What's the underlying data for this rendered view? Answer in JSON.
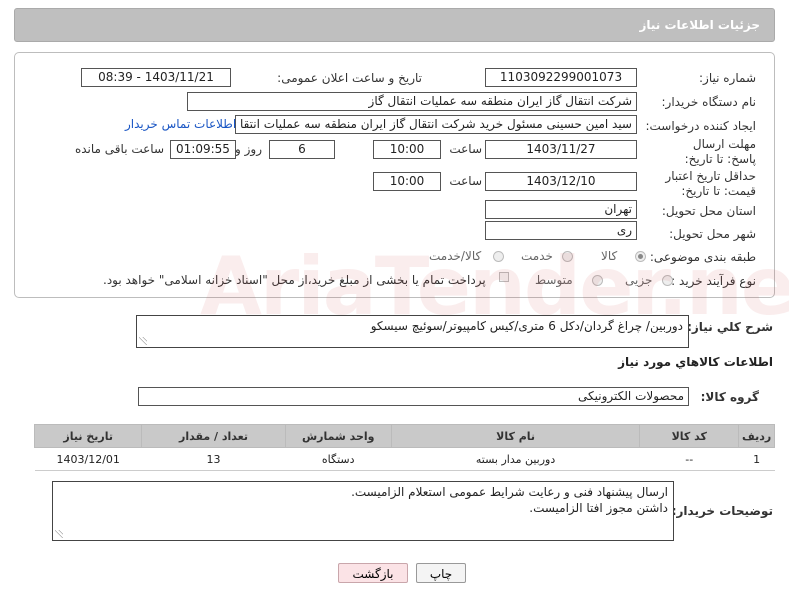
{
  "header": {
    "title": "جزئیات اطلاعات نیاز"
  },
  "labels": {
    "need_number": "شماره نیاز:",
    "announce_datetime": "تاریخ و ساعت اعلان عمومی:",
    "buyer_org": "نام دستگاه خریدار:",
    "requester": "ایجاد کننده درخواست:",
    "response_deadline": "مهلت ارسال پاسخ: تا تاریخ:",
    "price_validity": "حداقل تاریخ اعتبار قیمت: تا تاریخ:",
    "province": "استان محل تحویل:",
    "city": "شهر محل تحویل:",
    "category": "طبقه بندی موضوعی:",
    "process_type": "نوع فرآیند خرید :",
    "time": "ساعت",
    "day_and": "روز و",
    "remaining": "ساعت باقی مانده",
    "general_desc": "شرح کلي نياز:",
    "goods_info": "اطلاعات کالاهاي مورد نياز",
    "goods_group": "گروه کالا:",
    "buyer_notes": "توضیحات خریدار:"
  },
  "values": {
    "need_number": "1103092299001073",
    "announce_datetime": "1403/11/21 - 08:39",
    "buyer_org": "شرکت انتقال گاز ایران منطقه سه عملیات انتقال گاز",
    "requester": "سید امین حسینی مسئول خرید شرکت انتقال گاز ایران منطقه سه عملیات انتقا",
    "contact_link": "اطلاعات تماس خریدار",
    "response_date": "1403/11/27",
    "response_time": "10:00",
    "days": "6",
    "remaining_time": "01:09:55",
    "validity_date": "1403/12/10",
    "validity_time": "10:00",
    "province": "تهران",
    "city": "ری",
    "general_desc": "دوربین/ چراغ گردان/دکل 6 متری/کیس کامپیوتر/سوئیچ سیسکو",
    "goods_group": "محصولات الکترونیکی"
  },
  "category_options": [
    {
      "label": "کالا",
      "selected": true
    },
    {
      "label": "خدمت",
      "selected": false
    },
    {
      "label": "کالا/خدمت",
      "selected": false
    }
  ],
  "process_options": [
    {
      "label": "جزیی",
      "selected": false
    },
    {
      "label": "متوسط",
      "selected": false
    }
  ],
  "payment_note": "پرداخت تمام یا بخشی از مبلغ خرید،از محل \"اسناد خزانه اسلامی\" خواهد بود.",
  "table": {
    "headers": [
      "ردیف",
      "کد کالا",
      "نام کالا",
      "واحد شمارش",
      "تعداد / مقدار",
      "تاریخ نیاز"
    ],
    "rows": [
      [
        "1",
        "--",
        "دوربین مدار بسته",
        "دستگاه",
        "13",
        "1403/12/01"
      ]
    ]
  },
  "buyer_notes": [
    "ارسال پیشنهاد فنی و رعایت شرایط عمومی استعلام الزامیست.",
    "داشتن مجوز افتا الزامیست."
  ],
  "watermark": "AriaTender.net",
  "buttons": {
    "print": "چاپ",
    "back": "بازگشت"
  }
}
